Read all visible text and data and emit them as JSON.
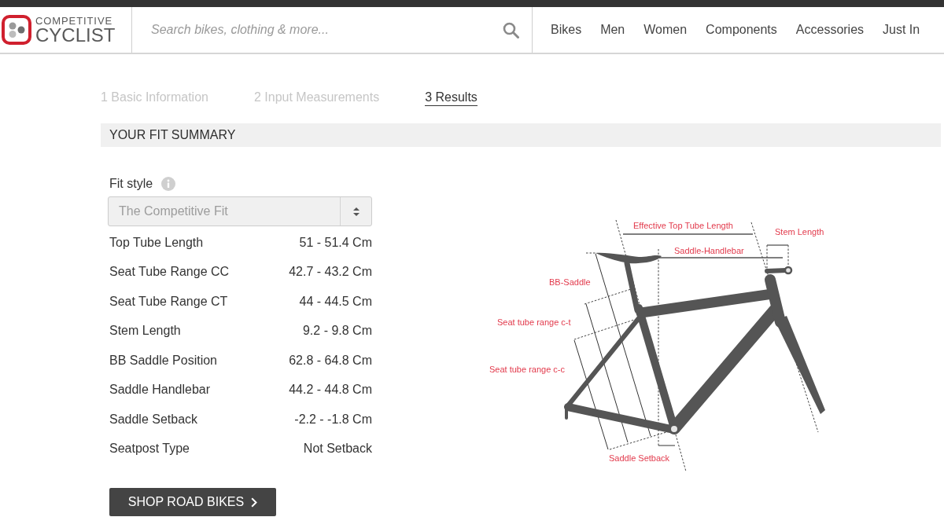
{
  "header": {
    "logo": {
      "line1": "COMPETITIVE",
      "line2": "CYCLIST"
    },
    "search": {
      "placeholder": "Search bikes, clothing & more..."
    },
    "nav": [
      "Bikes",
      "Men",
      "Women",
      "Components",
      "Accessories",
      "Just In"
    ]
  },
  "steps": [
    {
      "label": "1 Basic Information",
      "selected": false
    },
    {
      "label": "2 Input Measurements",
      "selected": false
    },
    {
      "label": "3 Results",
      "selected": true
    }
  ],
  "summary": {
    "title": "YOUR FIT SUMMARY",
    "fit_style": {
      "label": "Fit style",
      "select": {
        "value": "The Competitive Fit",
        "disabled": true
      }
    },
    "measurements": [
      {
        "name": "Top Tube Length",
        "value": "51 - 51.4 Cm"
      },
      {
        "name": "Seat Tube Range CC",
        "value": "42.7 - 43.2 Cm"
      },
      {
        "name": "Seat Tube Range CT",
        "value": "44 - 44.5 Cm"
      },
      {
        "name": "Stem Length",
        "value": "9.2 - 9.8 Cm"
      },
      {
        "name": "BB Saddle Position",
        "value": "62.8 - 64.8 Cm"
      },
      {
        "name": "Saddle Handlebar",
        "value": "44.2 - 44.8 Cm"
      },
      {
        "name": "Saddle Setback",
        "value": "-2.2 - -1.8 Cm"
      },
      {
        "name": "Seatpost Type",
        "value": "Not Setback"
      }
    ],
    "button": "SHOP ROAD BIKES",
    "diagram": {
      "labels": [
        "Effective Top Tube Length",
        "Stem Length",
        "Saddle-Handlebar",
        "BB-Saddle",
        "Seat tube range c-t",
        "Seat tube range c-c",
        "Saddle Setback"
      ]
    }
  }
}
